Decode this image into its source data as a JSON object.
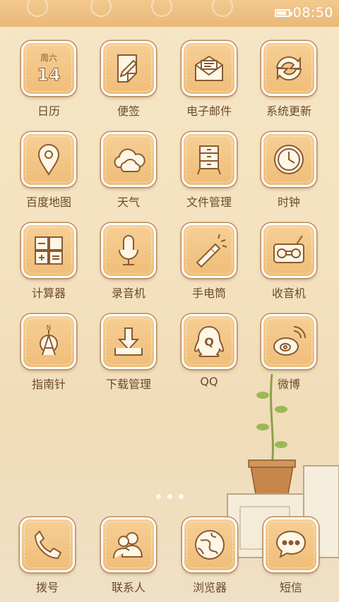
{
  "status_bar": {
    "time": "08:50",
    "battery_level": 0.85
  },
  "apps": [
    {
      "label": "日历",
      "icon": "calendar-icon",
      "date_weekday": "周六",
      "date_day": "14"
    },
    {
      "label": "便签",
      "icon": "note-icon"
    },
    {
      "label": "电子邮件",
      "icon": "mail-icon"
    },
    {
      "label": "系统更新",
      "icon": "refresh-icon"
    },
    {
      "label": "百度地图",
      "icon": "map-pin-icon"
    },
    {
      "label": "天气",
      "icon": "cloud-icon"
    },
    {
      "label": "文件管理",
      "icon": "file-cabinet-icon"
    },
    {
      "label": "时钟",
      "icon": "clock-icon"
    },
    {
      "label": "计算器",
      "icon": "calculator-icon"
    },
    {
      "label": "录音机",
      "icon": "microphone-icon"
    },
    {
      "label": "手电筒",
      "icon": "flashlight-icon"
    },
    {
      "label": "收音机",
      "icon": "radio-icon"
    },
    {
      "label": "指南针",
      "icon": "compass-icon"
    },
    {
      "label": "下载管理",
      "icon": "download-icon"
    },
    {
      "label": "QQ",
      "icon": "qq-icon"
    },
    {
      "label": "微博",
      "icon": "weibo-icon"
    }
  ],
  "page_indicator": {
    "pages": 3,
    "current": 1
  },
  "dock": [
    {
      "label": "拨号",
      "icon": "phone-icon"
    },
    {
      "label": "联系人",
      "icon": "contacts-icon"
    },
    {
      "label": "浏览器",
      "icon": "globe-icon"
    },
    {
      "label": "短信",
      "icon": "message-icon"
    }
  ],
  "colors": {
    "tile": "#f2c585",
    "stroke": "#8a5a30",
    "label": "#6b4a2e",
    "status_bar": "#eec084"
  }
}
